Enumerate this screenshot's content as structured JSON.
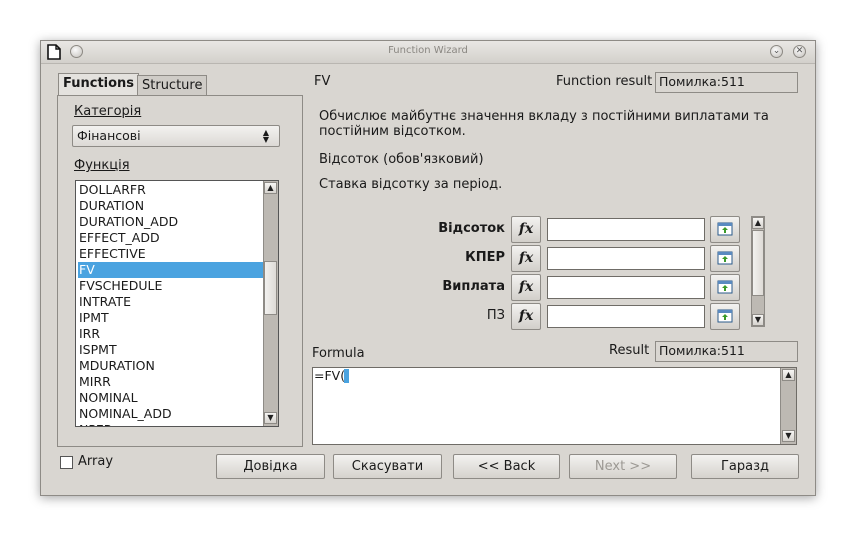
{
  "window": {
    "title": "Function Wizard"
  },
  "tabs": {
    "functions": "Functions",
    "structure": "Structure"
  },
  "left": {
    "category_label": "Категорія",
    "category_value": "Фінансові",
    "function_label": "Функція",
    "functions": [
      "DOLLARFR",
      "DURATION",
      "DURATION_ADD",
      "EFFECT_ADD",
      "EFFECTIVE",
      "FV",
      "FVSCHEDULE",
      "INTRATE",
      "IPMT",
      "IRR",
      "ISPMT",
      "MDURATION",
      "MIRR",
      "NOMINAL",
      "NOMINAL_ADD",
      "NPER"
    ],
    "selected_index": 5
  },
  "right": {
    "function_name": "FV",
    "function_result_label": "Function result",
    "function_result_value": "Помилка:511",
    "description": "Обчислює майбутнє значення вкладу з постійними виплатами та постійним відсотком.",
    "param_title": "Відсоток (обов'язковий)",
    "param_description": "Ставка відсотку за період.",
    "params": [
      {
        "label": "Відсоток",
        "bold": true,
        "value": ""
      },
      {
        "label": "КПЕР",
        "bold": true,
        "value": ""
      },
      {
        "label": "Виплата",
        "bold": true,
        "value": ""
      },
      {
        "label": "ПЗ",
        "bold": false,
        "value": ""
      }
    ],
    "fx_label": "fx",
    "formula_label": "Formula",
    "result_label": "Result",
    "result_value": "Помилка:511",
    "formula_text": "=FV()"
  },
  "footer": {
    "array_label": "Array",
    "help": "Довідка",
    "cancel": "Скасувати",
    "back": "<< Back",
    "next": "Next >>",
    "ok": "Гаразд"
  }
}
